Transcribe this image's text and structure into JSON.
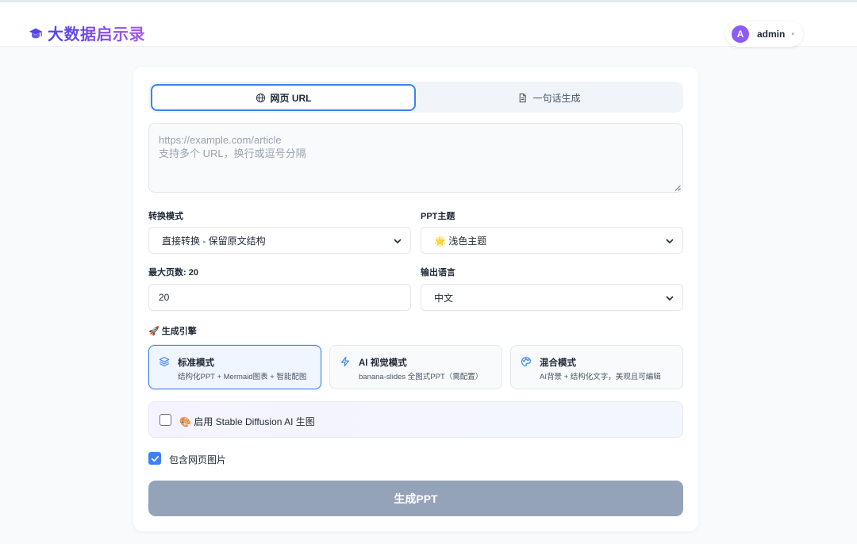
{
  "header": {
    "brand_title": "大数据启示录",
    "user": {
      "avatar_letter": "A",
      "name": "admin"
    }
  },
  "tabs": [
    {
      "label": "网页 URL",
      "active": true
    },
    {
      "label": "一句话生成",
      "active": false
    }
  ],
  "url_input": {
    "placeholder": "https://example.com/article\n支持多个 URL，换行或逗号分隔",
    "value": ""
  },
  "form": {
    "mode": {
      "label": "转换模式",
      "value": "直接转换 - 保留原文结构"
    },
    "theme": {
      "label": "PPT主题",
      "value": "🌟 浅色主题"
    },
    "max_pages": {
      "label": "最大页数: 20",
      "value": "20"
    },
    "language": {
      "label": "输出语言",
      "value": "中文"
    }
  },
  "engine": {
    "label": "🚀 生成引擎",
    "options": [
      {
        "title": "标准模式",
        "desc": "结构化PPT + Mermaid图表 + 智能配图",
        "icon": "layers-icon",
        "active": true
      },
      {
        "title": "AI 视觉模式",
        "desc": "banana-slides 全图式PPT（需配置）",
        "icon": "lightning-icon",
        "active": false
      },
      {
        "title": "混合模式",
        "desc": "AI背景 + 结构化文字，美观且可编辑",
        "icon": "palette-icon",
        "active": false
      }
    ]
  },
  "sd_option": {
    "label": "🎨 启用 Stable Diffusion AI 生图",
    "checked": false
  },
  "include_images": {
    "label": "包含网页图片",
    "checked": true
  },
  "submit_label": "生成PPT",
  "colors": {
    "primary": "#3b82f6",
    "avatar": "#8b5cf6",
    "brand_gradient_start": "#4f46e5",
    "brand_gradient_end": "#a855f7",
    "button_disabled": "#94a3b8"
  }
}
